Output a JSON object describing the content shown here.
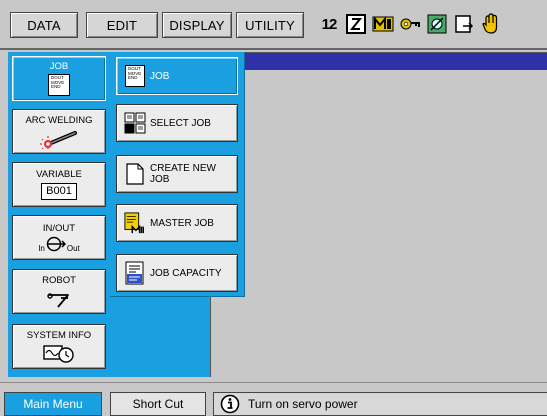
{
  "top_menu": {
    "items": [
      {
        "label": "DATA"
      },
      {
        "label": "EDIT"
      },
      {
        "label": "DISPLAY"
      },
      {
        "label": "UTILITY"
      }
    ],
    "status_icons": [
      "numbered-steps-icon",
      "cycle-mode-icon",
      "tool-icon",
      "key-icon",
      "servo-icon",
      "page-icon",
      "hand-icon"
    ],
    "status_numeral": "12"
  },
  "categories": [
    {
      "label": "JOB",
      "icon": "job-document-icon",
      "doc_lines": [
        "DOUT",
        "MOVE",
        "END"
      ],
      "active": true
    },
    {
      "label": "ARC WELDING",
      "icon": "welding-torch-icon",
      "active": false
    },
    {
      "label": "VARIABLE",
      "icon": "variable-box-icon",
      "value": "B001",
      "active": false
    },
    {
      "label": "IN/OUT",
      "icon": "inout-icon",
      "in_label": "In",
      "out_label": "Out",
      "active": false
    },
    {
      "label": "ROBOT",
      "icon": "robot-arm-icon",
      "active": false
    },
    {
      "label": "SYSTEM INFO",
      "icon": "system-info-icon",
      "active": false
    }
  ],
  "job_submenu": [
    {
      "label": "JOB",
      "icon": "job-document-icon",
      "doc_lines": [
        "DOUT",
        "MOVE",
        "END"
      ],
      "active": true
    },
    {
      "label": "SELECT JOB",
      "icon": "select-job-icon",
      "active": false
    },
    {
      "label": "CREATE NEW JOB",
      "icon": "new-document-icon",
      "active": false
    },
    {
      "label": "MASTER JOB",
      "icon": "master-job-icon",
      "active": false
    },
    {
      "label": "JOB CAPACITY",
      "icon": "job-capacity-icon",
      "active": false
    }
  ],
  "bottom": {
    "main_menu": "Main Menu",
    "short_cut": "Short Cut",
    "status_icon": "info-icon",
    "status_message": "Turn on servo power"
  },
  "colors": {
    "panel_blue": "#1aa0e0",
    "title_strip": "#3030a8",
    "background": "#c8c8c8"
  }
}
